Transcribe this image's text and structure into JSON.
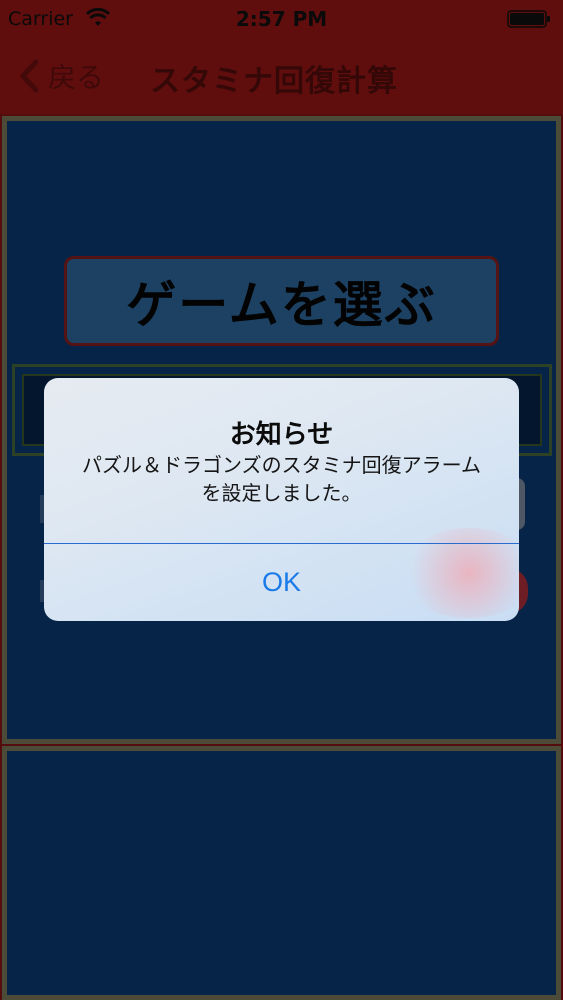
{
  "status_bar": {
    "carrier": "Carrier",
    "time": "2:57 PM",
    "wifi_icon": "wifi-icon",
    "battery_icon": "battery-icon"
  },
  "nav": {
    "back_label": "戻る",
    "title": "スタミナ回復計算"
  },
  "content": {
    "choose_game_label": "ゲームを選ぶ"
  },
  "alert": {
    "title": "お知らせ",
    "message": "パズル＆ドラゴンズのスタミナ回復アラームを設定しました。",
    "ok_label": "OK"
  },
  "colors": {
    "nav_bg": "#9a1515",
    "panel_bg": "#0a3a74",
    "accent": "#1a7ae8"
  }
}
